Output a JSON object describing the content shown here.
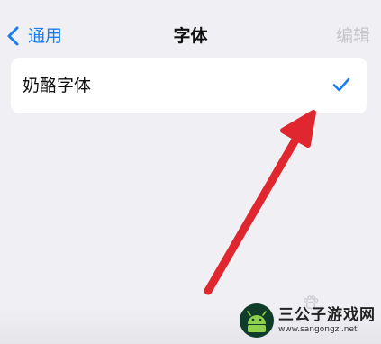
{
  "nav": {
    "back_label": "通用",
    "title": "字体",
    "edit_label": "编辑",
    "accent_color": "#1a7cf0"
  },
  "font_list": {
    "items": [
      {
        "label": "奶酪字体",
        "selected": true
      }
    ]
  },
  "annotation": {
    "arrow_color": "#e0262e"
  },
  "watermark": {
    "name": "三公子游戏网",
    "url": "www.sangongzi.net",
    "icon": "android-logo-icon"
  }
}
